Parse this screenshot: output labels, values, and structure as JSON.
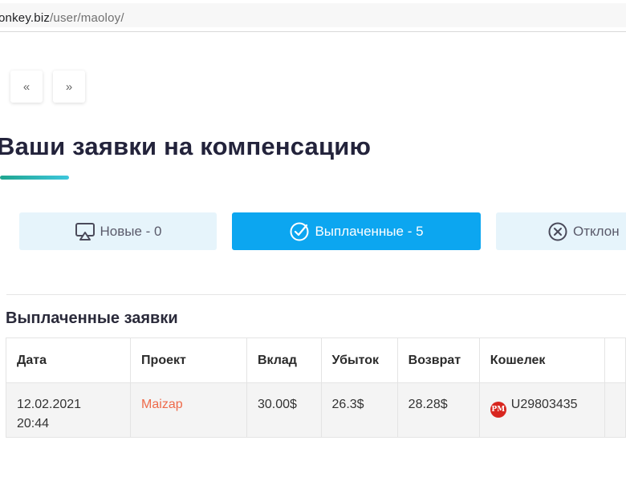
{
  "browser": {
    "url_host": "onkey.biz",
    "url_path": "/user/maoloy/"
  },
  "pager": {
    "prev_label": "«",
    "next_label": "»"
  },
  "page": {
    "title": "Ваши заявки на компенсацию"
  },
  "filters": [
    {
      "label": "Новые - 0",
      "icon": "airplay-icon"
    },
    {
      "label": "Выплаченные - 5",
      "icon": "check-circle-icon",
      "active": true
    },
    {
      "label": "Отклон",
      "icon": "x-circle-icon"
    }
  ],
  "section": {
    "title": "Выплаченные заявки"
  },
  "table": {
    "headers": [
      "Дата",
      "Проект",
      "Вклад",
      "Убыток",
      "Возврат",
      "Кошелек"
    ],
    "rows": [
      {
        "date": "12.02.2021",
        "time": "20:44",
        "project": "Maizap",
        "deposit": "30.00$",
        "loss": "26.3$",
        "refund": "28.28$",
        "wallet_icon_text": "PM",
        "wallet": "U29803435"
      }
    ]
  },
  "colors": {
    "accent": "#0ca6f0",
    "filter_bg": "#e6f4fb",
    "project_link": "#ee6a4a",
    "title_gradient_start": "#1fa58f",
    "title_gradient_end": "#3ec7dd"
  }
}
